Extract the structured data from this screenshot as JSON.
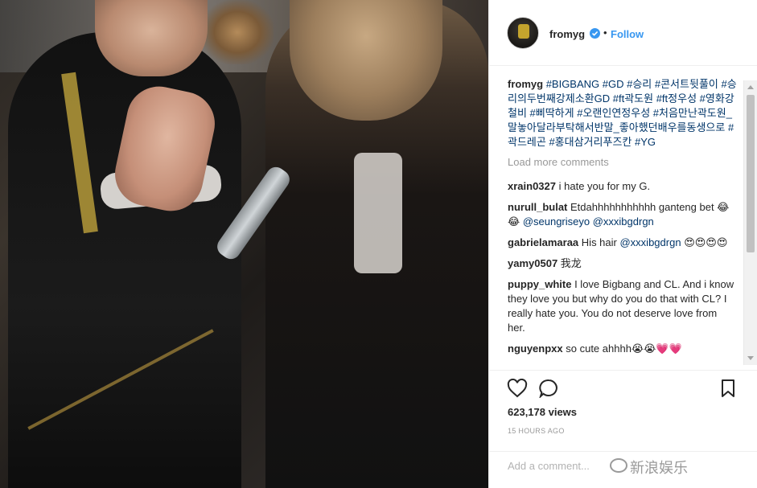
{
  "post": {
    "username": "fromyg",
    "follow_label": "Follow",
    "separator": "•",
    "caption_user": "fromyg",
    "caption_text": "#BIGBANG #GD #승리 #콘서트뒷풀이 #승리의두번째강제소환GD #ft곽도원 #ft정우성 #영화강철비 #삐딱하게 #오랜인연정우성 #처음만난곽도원_말놓아달라부탁해서반말_좋아했던배우를동생으로 #곽드레곤 #홍대삼거리푸즈칸 #YG",
    "load_more_label": "Load more comments",
    "comments": [
      {
        "user": "xrain0327",
        "text": "i hate you for my G."
      },
      {
        "user": "nurull_bulat",
        "text": "Etdahhhhhhhhhhh ganteng bet 😂😂 ",
        "mentions": "@seungriseyo @xxxibgdrgn"
      },
      {
        "user": "gabrielamaraa",
        "text": "His hair ",
        "mentions": "@xxxibgdrgn",
        "trail": " 😍😍😍😍"
      },
      {
        "user": "yamy0507",
        "text": "我龙"
      },
      {
        "user": "puppy_white",
        "text": "I love Bigbang and CL. And i know they love you but why do you do that with CL? I really hate you. You do not deserve love from her."
      },
      {
        "user": "nguyenpxx",
        "text": "so cute ahhhh😭😭💗💗"
      }
    ],
    "views": "623,178 views",
    "time": "15 HOURS AGO",
    "add_comment_placeholder": "Add a comment...",
    "watermark": "新浪娱乐"
  },
  "colors": {
    "accent": "#3897f0",
    "hashtag": "#003569",
    "muted": "#999999"
  },
  "icons": {
    "like": "heart-icon",
    "comment": "comment-bubble-icon",
    "save": "bookmark-icon",
    "verified": "verified-badge-icon"
  }
}
